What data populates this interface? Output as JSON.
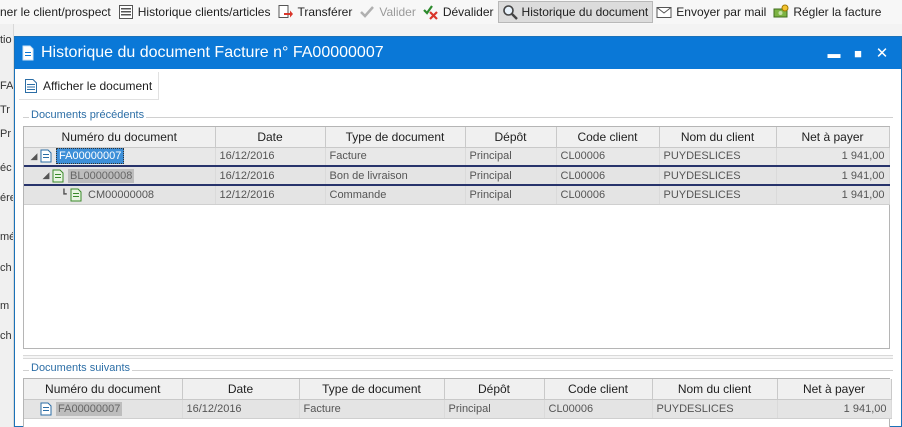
{
  "toolbar": {
    "items": [
      {
        "label": "ner le client/prospect"
      },
      {
        "label": "Historique clients/articles"
      },
      {
        "label": "Transférer"
      },
      {
        "label": "Valider"
      },
      {
        "label": "Dévalider"
      },
      {
        "label": "Historique du document"
      },
      {
        "label": "Envoyer par mail"
      },
      {
        "label": "Régler la facture"
      }
    ]
  },
  "background": {
    "fragments": [
      "tio",
      "FA",
      "Tr",
      "Pr",
      "éc",
      "ére",
      "mé",
      "ch",
      "m",
      "ch"
    ]
  },
  "dialog": {
    "title": "Historique du document Facture n° FA00000007",
    "minimize": "▬",
    "maximize": "■",
    "close": "✕",
    "show_document_label": "Afficher le document",
    "previous_section_label": "Documents précédents",
    "next_section_label": "Documents suivants",
    "columns": [
      "Numéro du document",
      "Date",
      "Type de document",
      "Dépôt",
      "Code client",
      "Nom du client",
      "Net à payer"
    ],
    "previous_rows": [
      {
        "number": "FA00000007",
        "date": "16/12/2016",
        "type": "Facture",
        "depot": "Principal",
        "client_code": "CL00006",
        "client_name": "PUYDESLICES",
        "net": "1 941,00"
      },
      {
        "number": "BL00000008",
        "date": "16/12/2016",
        "type": "Bon de livraison",
        "depot": "Principal",
        "client_code": "CL00006",
        "client_name": "PUYDESLICES",
        "net": "1 941,00"
      },
      {
        "number": "CM00000008",
        "date": "12/12/2016",
        "type": "Commande",
        "depot": "Principal",
        "client_code": "CL00006",
        "client_name": "PUYDESLICES",
        "net": "1 941,00"
      }
    ],
    "next_rows": [
      {
        "number": "FA00000007",
        "date": "16/12/2016",
        "type": "Facture",
        "depot": "Principal",
        "client_code": "CL00006",
        "client_name": "PUYDESLICES",
        "net": "1 941,00"
      }
    ]
  },
  "colors": {
    "title_bar": "#0a78d7",
    "section_label": "#2c6ea6",
    "selection": "#3d8fd8",
    "row_separator": "#27336b"
  }
}
